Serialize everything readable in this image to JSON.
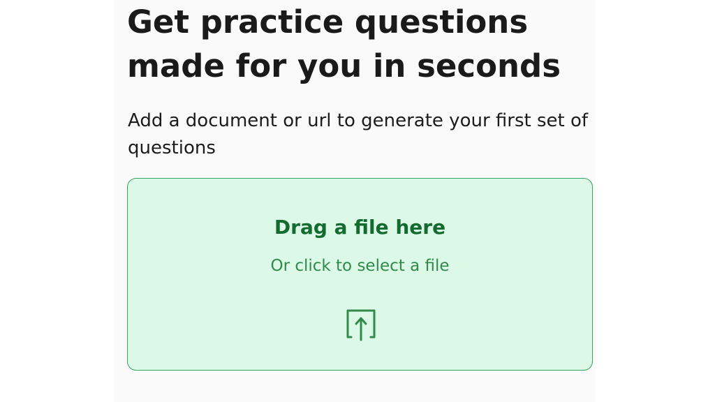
{
  "hero": {
    "title": "Get practice questions made for you in seconds",
    "subtitle": "Add a document or url to generate your first set of questions"
  },
  "dropzone": {
    "title": "Drag a file here",
    "subtitle": "Or click to select a file",
    "icon": "upload-icon"
  },
  "colors": {
    "dropzone_background": "#dcf8e6",
    "dropzone_border": "#3aa55b",
    "dropzone_title": "#136b30",
    "dropzone_subtitle": "#2f8a4b",
    "heading_text": "#1a1a1a"
  }
}
